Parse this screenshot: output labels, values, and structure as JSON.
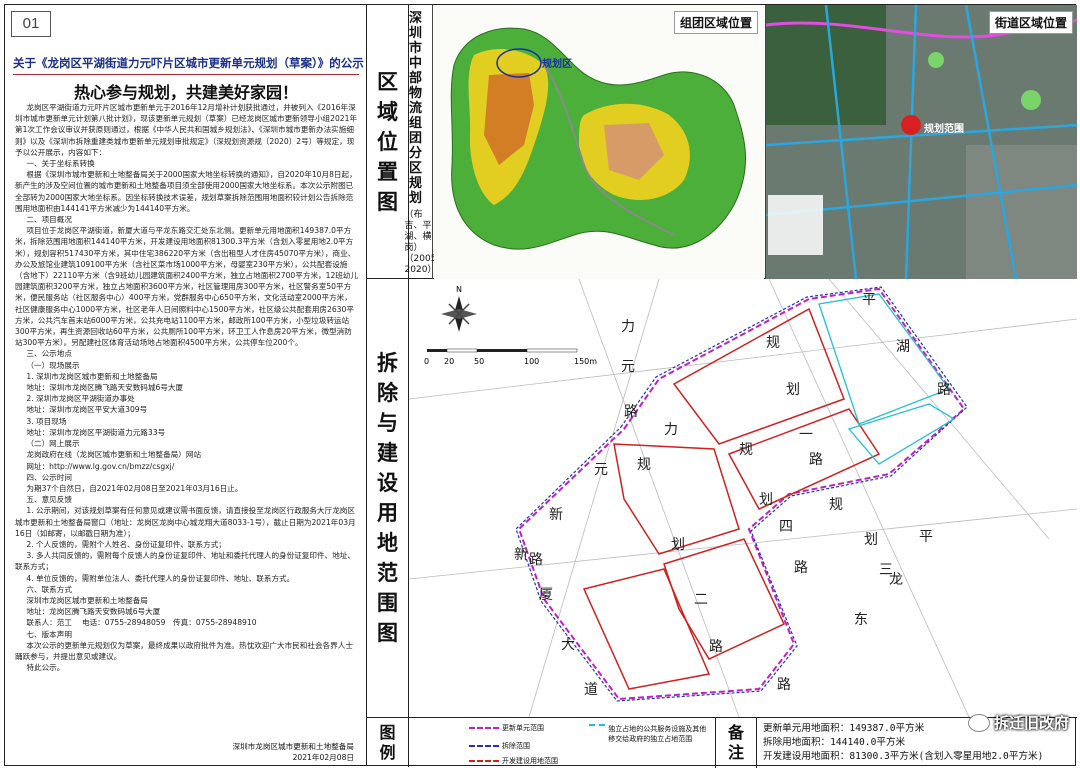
{
  "page_number": "01",
  "notice_title": "关于《龙岗区平湖街道力元吓片区城市更新单元规划（草案）》的公示",
  "slogan": "热心参与规划，共建美好家园！",
  "body": [
    {
      "cls": "ind",
      "text": "龙岗区平湖街道力元吓片区城市更新单元于2016年12月增补计划获批通过，并被列入《2016年深圳市城市更新单元计划第八批计划》，现该更新单元规划（草案）已经龙岗区城市更新领导小组2021年第1次工作会议审议并获原则通过，根据《中华人民共和国城乡规划法》、《深圳市城市更新办法实施细则》以及《深圳市拆除重建类城市更新单元规划审批规定》（深规划资源规〔2020〕2号）等规定，现予以公开展示，内容如下："
    },
    {
      "cls": "ind",
      "text": "一、关于坐标系转换"
    },
    {
      "cls": "ind",
      "text": "根据《深圳市城市更新和土地整备局关于2000国家大地坐标转换的通知》，自2020年10月8日起，新产生的涉及空间位置的城市更新和土地整备项目须全部使用2000国家大地坐标系。本次公示附图已全部转为2000国家大地坐标系。因坐标转换技术误差，规划草案拆除范围用地面积较计划公告拆除范围用地面积由144141平方米减少为144140平方米。"
    },
    {
      "cls": "ind",
      "text": "二、项目概况"
    },
    {
      "cls": "ind",
      "text": "项目位于龙岗区平湖街道，新厦大道与平龙东路交汇处东北侧。更新单元用地面积149387.0平方米，拆除范围用地面积144140平方米，开发建设用地面积81300.3平方米（含划入零星用地2.0平方米），规划容积517430平方米，其中住宅386220平方米（含出租型人才住房45070平方米），商业、办公及旅馆业建筑109100平方米（含社区菜市场1000平方米，母婴室230平方米），公共配套设施（含地下）22110平方米（含9班幼儿园建筑面积2400平方米，独立占地面积2700平方米，12班幼儿园建筑面积3200平方米，独立占地面积3600平方米，社区管理用房300平方米，社区警务室50平方米，便民服务站（社区服务中心）400平方米，党群服务中心650平方米，文化活动室2000平方米，社区健康服务中心1000平方米，社区老年人日间照料中心1500平方米，社区级公共配套用房2630平方米，公共汽车首末站6000平方米，公共充电站1100平方米，邮政所100平方米，小型垃圾转运站300平方米，再生资源回收站60平方米，公共厕所100平方米，环卫工人作息房20平方米，微型消防站300平方米）。另配建社区体育活动场地占地面积4500平方米，公共停车位200个。"
    },
    {
      "cls": "ind",
      "text": "三、公示地点"
    },
    {
      "cls": "ind",
      "text": "（一）现场展示"
    },
    {
      "cls": "ind",
      "text": "1. 深圳市龙岗区城市更新和土地整备局"
    },
    {
      "cls": "ind",
      "text": "地址：深圳市龙岗区腾飞路天安数码城6号大厦"
    },
    {
      "cls": "ind",
      "text": "2. 深圳市龙岗区平湖街道办事处"
    },
    {
      "cls": "ind",
      "text": "地址：深圳市龙岗区平安大道309号"
    },
    {
      "cls": "ind",
      "text": "3. 项目现场"
    },
    {
      "cls": "ind",
      "text": "地址：深圳市龙岗区平湖街道力元路33号"
    },
    {
      "cls": "ind",
      "text": "（二）网上展示"
    },
    {
      "cls": "ind",
      "text": "龙岗政府在线（龙岗区城市更新和土地整备局）网站"
    },
    {
      "cls": "ind",
      "text": "网址：http://www.lg.gov.cn/bmzz/csgxj/"
    },
    {
      "cls": "ind",
      "text": "四、公示时间"
    },
    {
      "cls": "ind",
      "text": "为期37个自然日，自2021年02月08日至2021年03月16日止。"
    },
    {
      "cls": "ind",
      "text": "五、意见反馈"
    },
    {
      "cls": "ind",
      "text": "1. 公示期间，对该规划草案有任何意见或建议需书面反馈，请直接投至龙岗区行政服务大厅龙岗区城市更新和土地整备局窗口（地址：龙岗区龙岗中心城龙翔大道8033-1号），截止日期为2021年03月16日（如邮寄，以邮戳日期为准）；"
    },
    {
      "cls": "ind",
      "text": "2. 个人反馈的，需附个人姓名、身份证复印件、联系方式；"
    },
    {
      "cls": "ind",
      "text": "3. 多人共同反馈的，需附每个反馈人的身份证复印件、地址和委托代理人的身份证复印件、地址、联系方式；"
    },
    {
      "cls": "ind",
      "text": "4. 单位反馈的，需附单位法人、委托代理人的身份证复印件、地址、联系方式。"
    },
    {
      "cls": "ind",
      "text": "六、联系方式"
    },
    {
      "cls": "ind",
      "text": "深圳市龙岗区城市更新和土地整备局"
    },
    {
      "cls": "ind",
      "text": "地址：龙岗区腾飞路天安数码城6号大厦"
    },
    {
      "cls": "ind",
      "text": "联系人：范工　 电话：0755-28948059　传真：0755-28948910"
    },
    {
      "cls": "ind",
      "text": "七、版本声明"
    },
    {
      "cls": "ind",
      "text": "本次公示的更新单元规划仅为草案，最终成果以政府批件为准。热忱欢迎广大市民和社会各界人士踊跃参与，并提出意见或建议。"
    },
    {
      "cls": "ind",
      "text": "特此公示。"
    }
  ],
  "signature": {
    "org": "深圳市龙岗区城市更新和土地整备局",
    "date": "2021年02月08日"
  },
  "strip_titles": {
    "location": "区域位置图",
    "demolition": "拆除与建设用地范围图",
    "legend": "图例",
    "notes": "备注"
  },
  "zone_vertical_title": "深圳市中部物流组团分区规划",
  "zone_vertical_sub": "（布吉、平湖、横岗）（2005-2020）",
  "zone_map_label": "组团区域位置",
  "zone_plan_area_label": "规划区",
  "street_map_label": "街道区域位置",
  "street_plan_label": "规划范围",
  "scale_bar": {
    "ticks": [
      "0",
      "20",
      "50",
      "100",
      "150m"
    ]
  },
  "road_labels": {
    "liyuan_road": [
      "力",
      "元",
      "路"
    ],
    "planned_road_1": [
      "规",
      "划",
      "一",
      "路"
    ],
    "pinghu_road": [
      "平",
      "湖",
      "路"
    ],
    "xinsha_avenue": [
      "新",
      "厦",
      "大",
      "道"
    ],
    "planned_road_2": [
      "规",
      "划",
      "二",
      "路"
    ],
    "liyuan_new_road": [
      "力",
      "元",
      "新",
      "路"
    ],
    "pinglong_east": [
      "平",
      "龙",
      "东",
      "路"
    ],
    "planned_road_3": [
      "规",
      "划",
      "三",
      "路"
    ],
    "planned_road_4": [
      "规",
      "划",
      "四",
      "路"
    ]
  },
  "legend_items": [
    {
      "label": "更新单元范围",
      "color": "#c020c0"
    },
    {
      "label": "拆除范围",
      "color": "#2030c0"
    },
    {
      "label": "开发建设用地范围",
      "color": "#d02020"
    },
    {
      "label": "独立占地的公共服务设施及其他移交给政府的独立占地范围",
      "color": "#20c0d0"
    }
  ],
  "notes": [
    "更新单元用地面积：149387.0平方米",
    "拆除用地面积：144140.0平方米",
    "开发建设用地面积：81300.3平方米(含划入零星用地2.0平方米)"
  ],
  "watermark": "拆迁旧改府"
}
